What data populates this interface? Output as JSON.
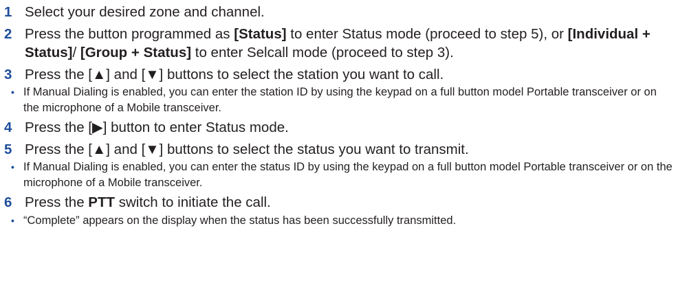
{
  "steps": [
    {
      "num": "1",
      "parts": [
        {
          "t": "Select your desired zone and channel."
        }
      ]
    },
    {
      "num": "2",
      "parts": [
        {
          "t": "Press the button programmed as "
        },
        {
          "t": "[Status]",
          "b": true
        },
        {
          "t": " to enter Status mode (proceed to step 5), or "
        },
        {
          "t": "[Individual + Status]",
          "b": true
        },
        {
          "t": "/ "
        },
        {
          "t": "[Group + Status]",
          "b": true
        },
        {
          "t": " to enter Selcall mode (proceed to step 3)."
        }
      ]
    },
    {
      "num": "3",
      "parts": [
        {
          "t": "Press the [▲] and [▼] buttons to select the station you want to call."
        }
      ],
      "note": "If Manual Dialing is enabled, you can enter the station ID by using the keypad on a full button model Portable transceiver or on the microphone of a Mobile transceiver."
    },
    {
      "num": "4",
      "parts": [
        {
          "t": "Press the [▶] button to enter Status mode."
        }
      ]
    },
    {
      "num": "5",
      "parts": [
        {
          "t": "Press the [▲] and [▼] buttons to select the status you want to transmit."
        }
      ],
      "note": "If Manual Dialing is enabled, you can enter the status ID by using the keypad on a full button model Portable transceiver or on the microphone of a Mobile transceiver."
    },
    {
      "num": "6",
      "parts": [
        {
          "t": "Press the "
        },
        {
          "t": "PTT",
          "b": true
        },
        {
          "t": " switch to initiate the call."
        }
      ],
      "note": "“Complete” appears on the display when the status has been successfully transmitted."
    }
  ],
  "colors": {
    "step_number": "#1f4e9c",
    "text": "#231f20"
  },
  "bullet_glyph": "•"
}
